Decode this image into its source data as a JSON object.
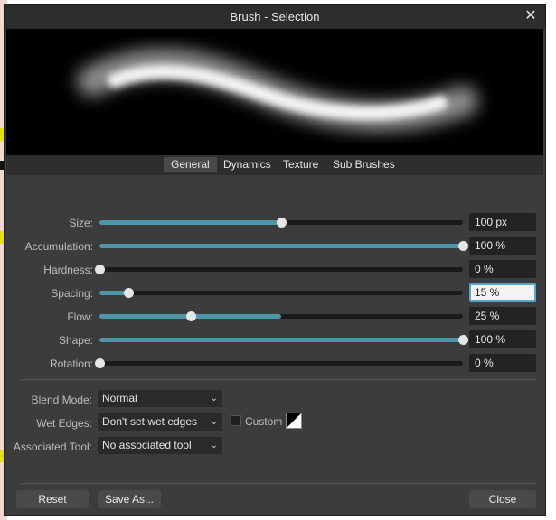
{
  "window": {
    "title": "Brush - Selection",
    "close_glyph": "✕"
  },
  "tabs": [
    {
      "label": "General",
      "active": true
    },
    {
      "label": "Dynamics",
      "active": false
    },
    {
      "label": "Texture",
      "active": false
    },
    {
      "label": "Sub Brushes",
      "active": false
    }
  ],
  "sliders": [
    {
      "label": "Size:",
      "value_text": "100 px",
      "fraction": 0.5
    },
    {
      "label": "Accumulation:",
      "value_text": "100 %",
      "fraction": 1.0
    },
    {
      "label": "Hardness:",
      "value_text": "0 %",
      "fraction": 0.0
    },
    {
      "label": "Spacing:",
      "value_text": "15 %",
      "fraction": 0.08
    },
    {
      "label": "Flow:",
      "value_text": "25 %",
      "fraction": 0.25
    },
    {
      "label": "Shape:",
      "value_text": "100 %",
      "fraction": 1.0
    },
    {
      "label": "Rotation:",
      "value_text": "0 %",
      "fraction": 0.0
    }
  ],
  "options": {
    "blend_mode": {
      "label": "Blend Mode:",
      "value": "Normal"
    },
    "wet_edges": {
      "label": "Wet Edges:",
      "value": "Don't set wet edges"
    },
    "custom_label": "Custom",
    "associated_tool": {
      "label": "Associated Tool:",
      "value": "No associated tool"
    }
  },
  "buttons": {
    "reset": "Reset",
    "save_as": "Save As...",
    "close": "Close"
  },
  "colors": {
    "accent": "#4e96a8",
    "panel": "#3c3c3c",
    "titlebar": "#2d2d2d"
  }
}
